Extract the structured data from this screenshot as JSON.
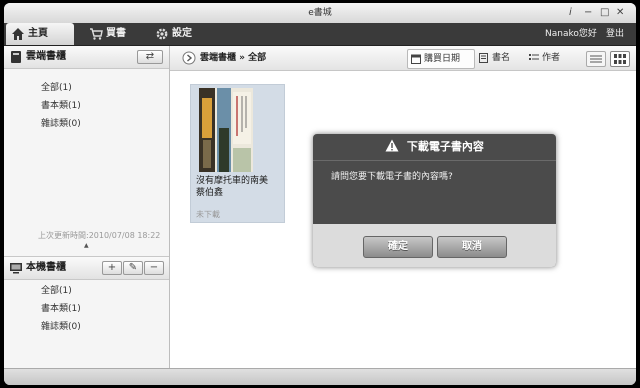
{
  "window": {
    "title": "e書城",
    "help": "i",
    "minimize": "−",
    "maximize": "□",
    "close": "✕"
  },
  "nav": {
    "tabs": [
      {
        "label": "主頁"
      },
      {
        "label": "買書"
      },
      {
        "label": "設定"
      }
    ],
    "greeting": "Nanako您好",
    "logout": "登出"
  },
  "sidebar": {
    "cloud": {
      "title": "雲端書櫃",
      "items": [
        {
          "label": "全部(1)"
        },
        {
          "label": "書本類(1)"
        },
        {
          "label": "雜誌類(0)"
        }
      ],
      "updated": "上次更新時間:2010/07/08 18:22"
    },
    "local": {
      "title": "本機書櫃",
      "items": [
        {
          "label": "全部(1)"
        },
        {
          "label": "書本類(1)"
        },
        {
          "label": "雜誌類(0)"
        }
      ],
      "add": "+",
      "edit": "✎",
      "remove": "−"
    }
  },
  "toolbar": {
    "breadcrumb_root": "雲端書櫃",
    "breadcrumb_sep": "»",
    "breadcrumb_current": "全部",
    "sort": [
      {
        "label": "購買日期"
      },
      {
        "label": "書名"
      },
      {
        "label": "作者"
      }
    ]
  },
  "books": [
    {
      "title": "沒有摩托車的南美",
      "author": "蔡伯鑫",
      "status": "未下載"
    }
  ],
  "dialog": {
    "title": "下載電子書內容",
    "message": "請問您要下載電子書的內容嗎?",
    "confirm": "確定",
    "cancel": "取消"
  }
}
